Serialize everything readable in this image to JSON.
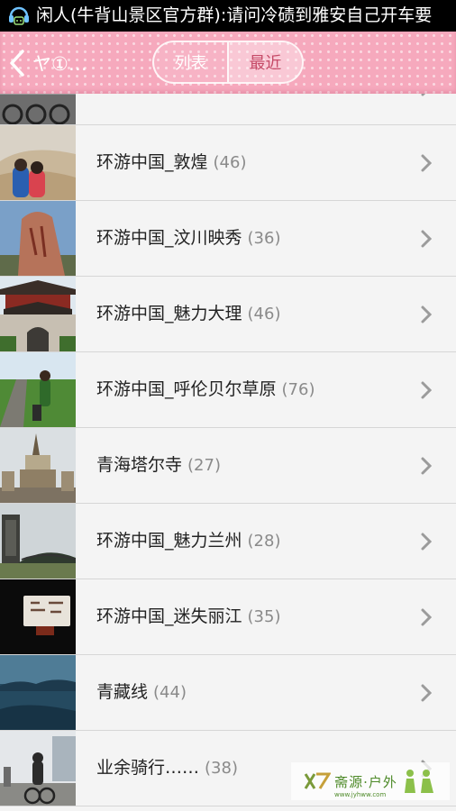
{
  "status_bar": {
    "notification_text": "闲人(牛背山景区官方群):请问冷碛到雅安自己开车要"
  },
  "header": {
    "title": "ヤ①…",
    "tabs": [
      {
        "label": "列表",
        "active": false
      },
      {
        "label": "最近",
        "active": true
      }
    ],
    "accent_color": "#f6a9bd"
  },
  "albums": [
    {
      "name": "",
      "count": "",
      "partial": true
    },
    {
      "name": "环游中国_敦煌",
      "count": "(46)"
    },
    {
      "name": "环游中国_汶川映秀",
      "count": "(36)"
    },
    {
      "name": "环游中国_魅力大理",
      "count": "(46)"
    },
    {
      "name": "环游中国_呼伦贝尔草原",
      "count": "(76)"
    },
    {
      "name": "青海塔尔寺",
      "count": "(27)"
    },
    {
      "name": "环游中国_魅力兰州",
      "count": "(28)"
    },
    {
      "name": "环游中国_迷失丽江",
      "count": "(35)"
    },
    {
      "name": "青藏线",
      "count": "(44)"
    },
    {
      "name": "业余骑行……",
      "count": "(38)"
    }
  ],
  "watermark": {
    "text": "斋源·户外",
    "sub": "www.jyhww.com"
  }
}
